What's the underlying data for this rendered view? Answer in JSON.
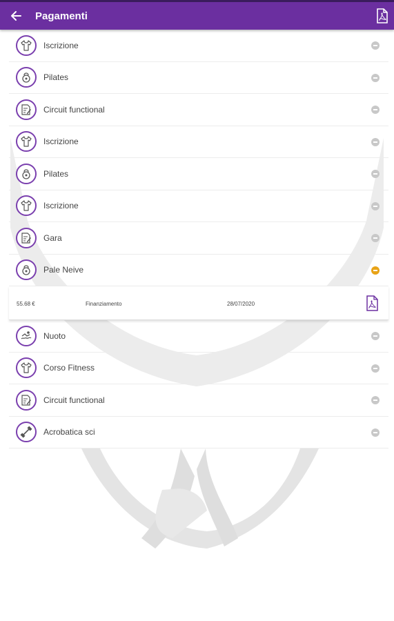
{
  "header": {
    "title": "Pagamenti",
    "back_icon": "arrow-left-icon",
    "action_icon": "pdf-icon"
  },
  "colors": {
    "primary": "#6b2fa0",
    "status_inactive": "#c8c8c8",
    "status_active": "#e8a317"
  },
  "payments": [
    {
      "label": "Iscrizione",
      "icon": "tshirt-icon"
    },
    {
      "label": "Pilates",
      "icon": "kettlebell-icon"
    },
    {
      "label": "Circuit functional",
      "icon": "document-edit-icon"
    },
    {
      "label": "Iscrizione",
      "icon": "tshirt-icon"
    },
    {
      "label": "Pilates",
      "icon": "kettlebell-icon"
    },
    {
      "label": "Iscrizione",
      "icon": "tshirt-icon"
    },
    {
      "label": "Gara",
      "icon": "document-edit-icon"
    },
    {
      "label": "Pale Neive",
      "icon": "kettlebell-icon",
      "expanded": true
    },
    {
      "label": "Nuoto",
      "icon": "swimmer-icon"
    },
    {
      "label": "Corso Fitness",
      "icon": "tshirt-icon"
    },
    {
      "label": "Circuit functional",
      "icon": "document-edit-icon"
    },
    {
      "label": "Acrobatica sci",
      "icon": "dumbbell-icon"
    }
  ],
  "detail": {
    "amount": "55.68 €",
    "type": "Finanziamento",
    "date": "28/07/2020"
  }
}
